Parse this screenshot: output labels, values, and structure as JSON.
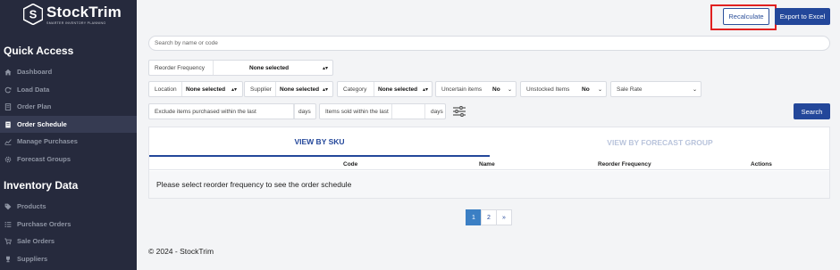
{
  "brand": {
    "name": "StockTrim",
    "tagline": "SMARTER INVENTORY PLANNING"
  },
  "sidebar": {
    "quick_access_title": "Quick Access",
    "quick_access": [
      {
        "label": "Dashboard",
        "icon": "home-icon",
        "active": false
      },
      {
        "label": "Load Data",
        "icon": "refresh-icon",
        "active": false
      },
      {
        "label": "Order Plan",
        "icon": "document-icon",
        "active": false
      },
      {
        "label": "Order Schedule",
        "icon": "document-icon",
        "active": true
      },
      {
        "label": "Manage Purchases",
        "icon": "chart-icon",
        "active": false
      },
      {
        "label": "Forecast Groups",
        "icon": "gear-icon",
        "active": false
      }
    ],
    "inventory_title": "Inventory Data",
    "inventory": [
      {
        "label": "Products",
        "icon": "tag-icon"
      },
      {
        "label": "Purchase Orders",
        "icon": "list-icon"
      },
      {
        "label": "Sale Orders",
        "icon": "cart-icon"
      },
      {
        "label": "Suppliers",
        "icon": "trophy-icon"
      }
    ]
  },
  "toolbar": {
    "recalculate_label": "Recalculate",
    "export_label": "Export to Excel"
  },
  "search": {
    "placeholder": "Search by name or code",
    "button_label": "Search"
  },
  "filters": {
    "reorder_frequency": {
      "label": "Reorder Frequency",
      "value": "None selected"
    },
    "location": {
      "label": "Location",
      "value": "None selected"
    },
    "supplier": {
      "label": "Supplier",
      "value": "None selected"
    },
    "category": {
      "label": "Category",
      "value": "None selected"
    },
    "uncertain_items": {
      "label": "Uncertain items",
      "value": "No"
    },
    "unstocked_items": {
      "label": "Unstocked Items",
      "value": "No"
    },
    "sale_rate": {
      "label": "Sale Rate",
      "value": ""
    },
    "exclude_purchased": {
      "label": "Exclude items purchased within the last",
      "suffix": "days",
      "value": ""
    },
    "items_sold": {
      "label": "Items sold within the last",
      "suffix": "days",
      "value": ""
    }
  },
  "tabs": [
    {
      "label": "VIEW BY SKU",
      "active": true
    },
    {
      "label": "VIEW BY FORECAST GROUP",
      "active": false
    }
  ],
  "table": {
    "columns": [
      "Code",
      "Name",
      "Reorder Frequency",
      "Actions"
    ],
    "empty_message": "Please select reorder frequency to see the order schedule"
  },
  "pagination": {
    "pages": [
      "1",
      "2"
    ],
    "next": "»",
    "current": "1"
  },
  "footer": {
    "text": "© 2024 - StockTrim"
  },
  "colors": {
    "sidebar_bg": "#262a3d",
    "primary": "#23479a",
    "highlight": "#e02020",
    "active_page": "#3b7fc4"
  }
}
